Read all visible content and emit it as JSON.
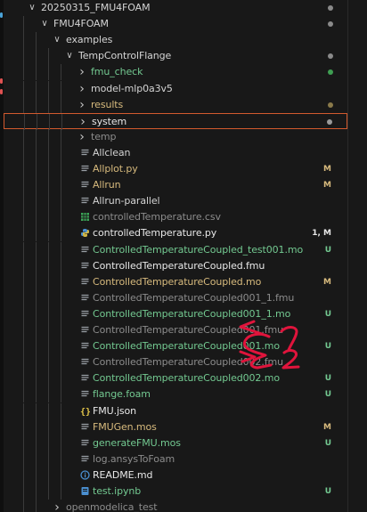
{
  "explorer": {
    "rows": [
      {
        "label": "20250315_FMU4FOAM",
        "depth": 0,
        "kind": "folder",
        "expanded": true,
        "color": "#d4d4d4",
        "badge": "",
        "dot": "#8a8a8a"
      },
      {
        "label": "FMU4FOAM",
        "depth": 1,
        "kind": "folder",
        "expanded": true,
        "color": "#d4d4d4",
        "badge": "",
        "dot": "#8a8a8a"
      },
      {
        "label": "examples",
        "depth": 2,
        "kind": "folder",
        "expanded": true,
        "color": "#d4d4d4",
        "badge": "",
        "dot": ""
      },
      {
        "label": "TempControlFlange",
        "depth": 3,
        "kind": "folder",
        "expanded": true,
        "color": "#d4d4d4",
        "badge": "",
        "dot": "#8a8a8a"
      },
      {
        "label": "fmu_check",
        "depth": 4,
        "kind": "folder",
        "expanded": false,
        "color": "#73c991",
        "badge": "",
        "dot": "#3f9e52"
      },
      {
        "label": "model-mlp0a3v5",
        "depth": 4,
        "kind": "folder",
        "expanded": false,
        "color": "#d4d4d4",
        "badge": "",
        "dot": ""
      },
      {
        "label": "results",
        "depth": 4,
        "kind": "folder",
        "expanded": false,
        "color": "#d7ba7d",
        "badge": "",
        "dot": "#8a7a4a"
      },
      {
        "label": "system",
        "depth": 4,
        "kind": "folder",
        "expanded": false,
        "color": "#e8e8e8",
        "badge": "",
        "dot": "#9a9a9a",
        "selected": true
      },
      {
        "label": "temp",
        "depth": 4,
        "kind": "folder",
        "expanded": false,
        "color": "#8c8c8c",
        "badge": "",
        "dot": ""
      },
      {
        "label": "Allclean",
        "depth": 4,
        "kind": "file",
        "icon": "lines",
        "color": "#d4d4d4",
        "badge": "",
        "dot": ""
      },
      {
        "label": "Allplot.py",
        "depth": 4,
        "kind": "file",
        "icon": "lines",
        "color": "#d7ba7d",
        "badge": "M",
        "dot": ""
      },
      {
        "label": "Allrun",
        "depth": 4,
        "kind": "file",
        "icon": "lines",
        "color": "#d7ba7d",
        "badge": "M",
        "dot": ""
      },
      {
        "label": "Allrun-parallel",
        "depth": 4,
        "kind": "file",
        "icon": "lines",
        "color": "#d4d4d4",
        "badge": "",
        "dot": ""
      },
      {
        "label": "controlledTemperature.csv",
        "depth": 4,
        "kind": "file",
        "icon": "csv",
        "color": "#8c8c8c",
        "badge": "",
        "dot": ""
      },
      {
        "label": "controlledTemperature.py",
        "depth": 4,
        "kind": "file",
        "icon": "python",
        "color": "#e8e8e8",
        "badge": "1, M",
        "dot": ""
      },
      {
        "label": "ControlledTemperatureCoupled_test001.mo",
        "depth": 4,
        "kind": "file",
        "icon": "lines",
        "color": "#73c991",
        "badge": "U",
        "dot": ""
      },
      {
        "label": "ControlledTemperatureCoupled.fmu",
        "depth": 4,
        "kind": "file",
        "icon": "lines",
        "color": "#e8e8e8",
        "badge": "",
        "dot": ""
      },
      {
        "label": "ControlledTemperatureCoupled.mo",
        "depth": 4,
        "kind": "file",
        "icon": "lines",
        "color": "#d7ba7d",
        "badge": "M",
        "dot": ""
      },
      {
        "label": "ControlledTemperatureCoupled001_1.fmu",
        "depth": 4,
        "kind": "file",
        "icon": "lines",
        "color": "#8c8c8c",
        "badge": "",
        "dot": ""
      },
      {
        "label": "ControlledTemperatureCoupled001_1.mo",
        "depth": 4,
        "kind": "file",
        "icon": "lines",
        "color": "#73c991",
        "badge": "U",
        "dot": ""
      },
      {
        "label": "ControlledTemperatureCoupled001.fmu",
        "depth": 4,
        "kind": "file",
        "icon": "lines",
        "color": "#8c8c8c",
        "badge": "",
        "dot": ""
      },
      {
        "label": "ControlledTemperatureCoupled001.mo",
        "depth": 4,
        "kind": "file",
        "icon": "lines",
        "color": "#73c991",
        "badge": "U",
        "dot": ""
      },
      {
        "label": "ControlledTemperatureCoupled002.fmu",
        "depth": 4,
        "kind": "file",
        "icon": "lines",
        "color": "#8c8c8c",
        "badge": "",
        "dot": ""
      },
      {
        "label": "ControlledTemperatureCoupled002.mo",
        "depth": 4,
        "kind": "file",
        "icon": "lines",
        "color": "#73c991",
        "badge": "U",
        "dot": ""
      },
      {
        "label": "flange.foam",
        "depth": 4,
        "kind": "file",
        "icon": "lines",
        "color": "#73c991",
        "badge": "U",
        "dot": ""
      },
      {
        "label": "FMU.json",
        "depth": 4,
        "kind": "file",
        "icon": "json",
        "color": "#e8e8e8",
        "badge": "",
        "dot": ""
      },
      {
        "label": "FMUGen.mos",
        "depth": 4,
        "kind": "file",
        "icon": "lines",
        "color": "#d7ba7d",
        "badge": "M",
        "dot": ""
      },
      {
        "label": "generateFMU.mos",
        "depth": 4,
        "kind": "file",
        "icon": "lines",
        "color": "#73c991",
        "badge": "U",
        "dot": ""
      },
      {
        "label": "log.ansysToFoam",
        "depth": 4,
        "kind": "file",
        "icon": "lines",
        "color": "#8c8c8c",
        "badge": "",
        "dot": ""
      },
      {
        "label": "README.md",
        "depth": 4,
        "kind": "file",
        "icon": "info",
        "color": "#e8e8e8",
        "badge": "",
        "dot": ""
      },
      {
        "label": "test.ipynb",
        "depth": 4,
        "kind": "file",
        "icon": "notebook",
        "color": "#73c991",
        "badge": "U",
        "dot": ""
      },
      {
        "label": "openmodelica_test",
        "depth": 2,
        "kind": "folder",
        "expanded": false,
        "color": "#8c8c8c",
        "badge": "",
        "dot": ""
      }
    ]
  },
  "annotation": {
    "marks": [
      "1",
      "2"
    ],
    "color": "#e0143c"
  },
  "colors": {
    "background": "#181818",
    "modified": "#d7ba7d",
    "untracked": "#73c991",
    "selection_border": "#d25a2e"
  }
}
